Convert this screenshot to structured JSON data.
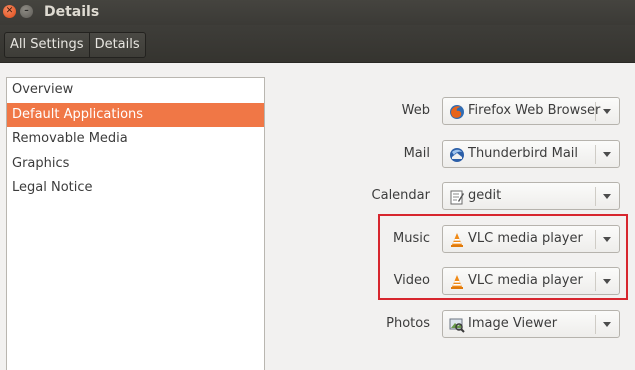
{
  "window": {
    "title": "Details"
  },
  "breadcrumb": [
    {
      "label": "All Settings"
    },
    {
      "label": "Details"
    }
  ],
  "sidebar": {
    "items": [
      {
        "label": "Overview"
      },
      {
        "label": "Default Applications",
        "selected": true
      },
      {
        "label": "Removable Media"
      },
      {
        "label": "Graphics"
      },
      {
        "label": "Legal Notice"
      }
    ]
  },
  "defaults": [
    {
      "label": "Web",
      "app": "Firefox Web Browser",
      "icon": "firefox-icon"
    },
    {
      "label": "Mail",
      "app": "Thunderbird Mail",
      "icon": "thunderbird-icon"
    },
    {
      "label": "Calendar",
      "app": "gedit",
      "icon": "gedit-icon"
    },
    {
      "label": "Music",
      "app": "VLC media player",
      "icon": "vlc-icon"
    },
    {
      "label": "Video",
      "app": "VLC media player",
      "icon": "vlc-icon"
    },
    {
      "label": "Photos",
      "app": "Image Viewer",
      "icon": "image-viewer-icon"
    }
  ],
  "colors": {
    "selection": "#f07746",
    "highlight_box": "#d7262e"
  }
}
